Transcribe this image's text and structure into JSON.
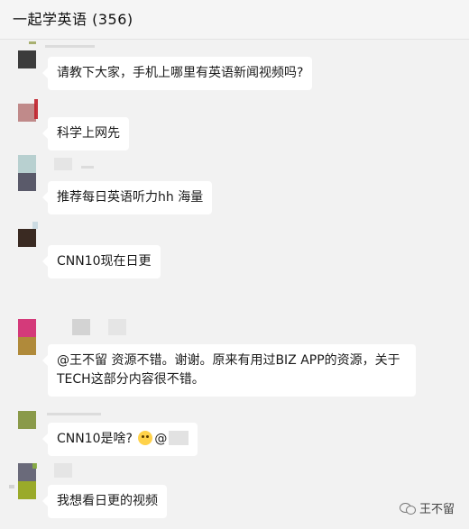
{
  "window": {
    "title": "一起学英语 (356)"
  },
  "messages": [
    {
      "text": "请教下大家，手机上哪里有英语新闻视频吗?"
    },
    {
      "text": "科学上网先"
    },
    {
      "text": "推荐每日英语听力hh  海量"
    },
    {
      "text": "CNN10现在日更"
    },
    {
      "line1": "@王不留 资源不错。谢谢。原来有用过BIZ APP的资源，关于",
      "line2": "TECH这部分内容很不错。"
    },
    {
      "text": "CNN10是啥?",
      "suffix": "@"
    },
    {
      "text": "我想看日更的视频"
    }
  ],
  "watermark": {
    "icon": "wechat-icon",
    "label": "王不留"
  },
  "colors": {
    "background": "#f2f2f2",
    "bubble": "#ffffff",
    "avatar_1": "#3c3c3c",
    "avatar_2": "#c08a8a",
    "avatar_3": "#5a5a6a",
    "avatar_4": "#3a2a22",
    "avatar_5a": "#d43a7a",
    "avatar_5b": "#b08a3a",
    "avatar_6": "#8a9a4a",
    "avatar_7a": "#6a6a7a",
    "avatar_7b": "#9aaa2a"
  }
}
